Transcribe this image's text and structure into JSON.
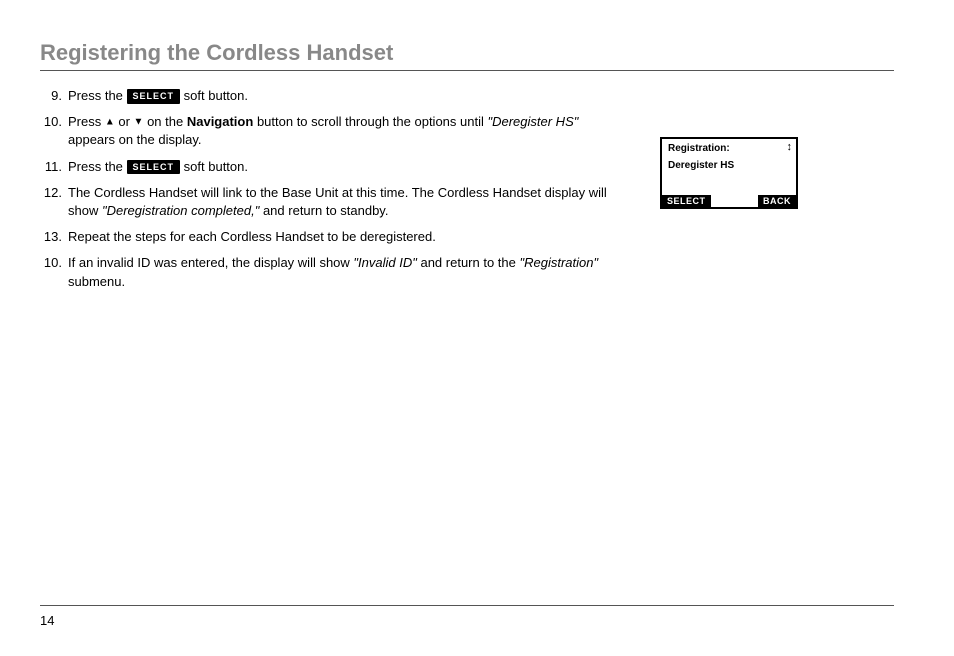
{
  "heading": "Registering the Cordless Handset",
  "select_label": "SELECT",
  "items": [
    {
      "num": "9.",
      "prefix": "Press the ",
      "select": true,
      "suffix": " soft button."
    },
    {
      "num": "10.",
      "text_a": "Press ",
      "text_b": " or ",
      "text_c": " on the ",
      "bold": "Navigation",
      "text_d": " button to scroll through the options until ",
      "italic": "\"Deregister HS\"",
      "text_e": " appears on the display."
    },
    {
      "num": "11.",
      "prefix": "Press the ",
      "select": true,
      "suffix": " soft button."
    },
    {
      "num": "12.",
      "text_a": "The Cordless Handset will link to the Base Unit at this time. The Cordless Handset display will show ",
      "italic": "\"Deregistration completed,\"",
      "text_b": " and return to standby."
    },
    {
      "num": "13.",
      "text": "Repeat the steps for each Cordless Handset to be deregistered."
    },
    {
      "num": "10.",
      "text_a": "If an invalid ID was entered, the display will show ",
      "italic1": "\"Invalid ID\"",
      "text_b": " and return to the ",
      "italic2": "\"Registration\"",
      "text_c": " submenu."
    }
  ],
  "lcd": {
    "title": "Registration:",
    "line": "Deregister HS",
    "left": "SELECT",
    "right": "BACK"
  },
  "page_number": "14"
}
